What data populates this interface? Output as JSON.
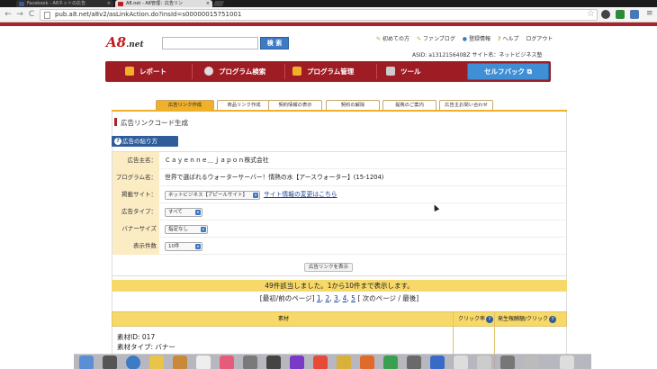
{
  "browser": {
    "tabs": [
      {
        "label": "Facebook - A8ネットの広告",
        "close": "×"
      },
      {
        "label": "A8.net - A8管理：広告リン",
        "close": "×"
      }
    ],
    "url": "pub.a8.net/a8v2/asLinkAction.do?insId=s00000015751001",
    "back": "←",
    "forward": "→",
    "reload": "C",
    "star": "☆",
    "menu": "≡"
  },
  "header": {
    "logo_main": "A8",
    "logo_sub": ".net",
    "search_placeholder": "",
    "search_button": "検 索",
    "links": [
      "初めての方",
      "ファンブログ",
      "登録情報",
      "ヘルプ",
      "ログアウト"
    ],
    "asid_line": "ASID: a13121564​0BZ   サイト名：ネットビジネス塾"
  },
  "nav": {
    "items": [
      "レポート",
      "プログラム検索",
      "プログラム管理",
      "ツール"
    ],
    "selfback": "セルフバック"
  },
  "subtabs": [
    "広告リンク作成",
    "商品リンク作成",
    "契約情報の表示",
    "契約の解除",
    "提携のご案内",
    "広告主お問い合わせ"
  ],
  "page": {
    "title": "広告リンクコード生成",
    "how_button": "広告の貼り方",
    "how_icon": "?"
  },
  "form": {
    "rows": [
      {
        "label": "広告主名：",
        "value": "Ｃａｙｅｎｎｅ＿ｊａｐｏｎ株式会社"
      },
      {
        "label": "プログラム名：",
        "value": "世界で選ばれるウォーターサーバー！情熱の水【アースウォーター】(15-1204)"
      },
      {
        "label": "掲載サイト：",
        "select": "ネットビジネス【アピールサイト】",
        "link": "サイト情報の変更はこちら"
      },
      {
        "label": "広告タイプ：",
        "select": "すべて"
      },
      {
        "label": "バナーサイズ",
        "select": "指定なし"
      },
      {
        "label": "表示件数",
        "select": "10件"
      }
    ],
    "display_button": "広告リンクを表示"
  },
  "results": {
    "summary": "49件該当しました。1から10件まで表示します。",
    "pager_prefix": "[最初/前のページ]",
    "pages": [
      "1",
      "2",
      "3",
      "4",
      "5"
    ],
    "pager_suffix": "[ 次のページ / 最後]"
  },
  "table": {
    "headers": [
      "素材",
      "クリック率",
      "発生報酬額/クリック"
    ],
    "rows": [
      {
        "id_line": "素材ID: 017",
        "type_line": "素材タイプ: バナー"
      }
    ]
  },
  "colors": {
    "brand_red": "#a8232a",
    "accent_blue": "#3f8fd6",
    "tab_gold": "#f1b02a",
    "label_bg": "#fcecc4"
  }
}
